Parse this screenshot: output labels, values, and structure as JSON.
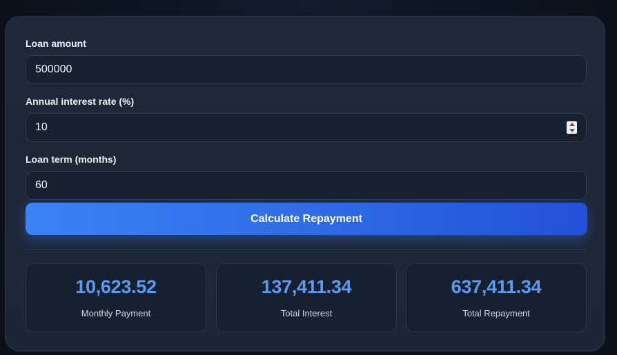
{
  "form": {
    "loan_amount": {
      "label": "Loan amount",
      "value": "500000"
    },
    "interest_rate": {
      "label": "Annual interest rate (%)",
      "value": "10"
    },
    "loan_term": {
      "label": "Loan term (months)",
      "value": "60"
    },
    "calculate_label": "Calculate Repayment"
  },
  "results": [
    {
      "value": "10,623.52",
      "caption": "Monthly Payment"
    },
    {
      "value": "137,411.34",
      "caption": "Total Interest"
    },
    {
      "value": "637,411.34",
      "caption": "Total Repayment"
    }
  ],
  "colors": {
    "accent": "#3b82f6",
    "result_value": "#5a9cf0",
    "card_background": "#1f2838"
  }
}
